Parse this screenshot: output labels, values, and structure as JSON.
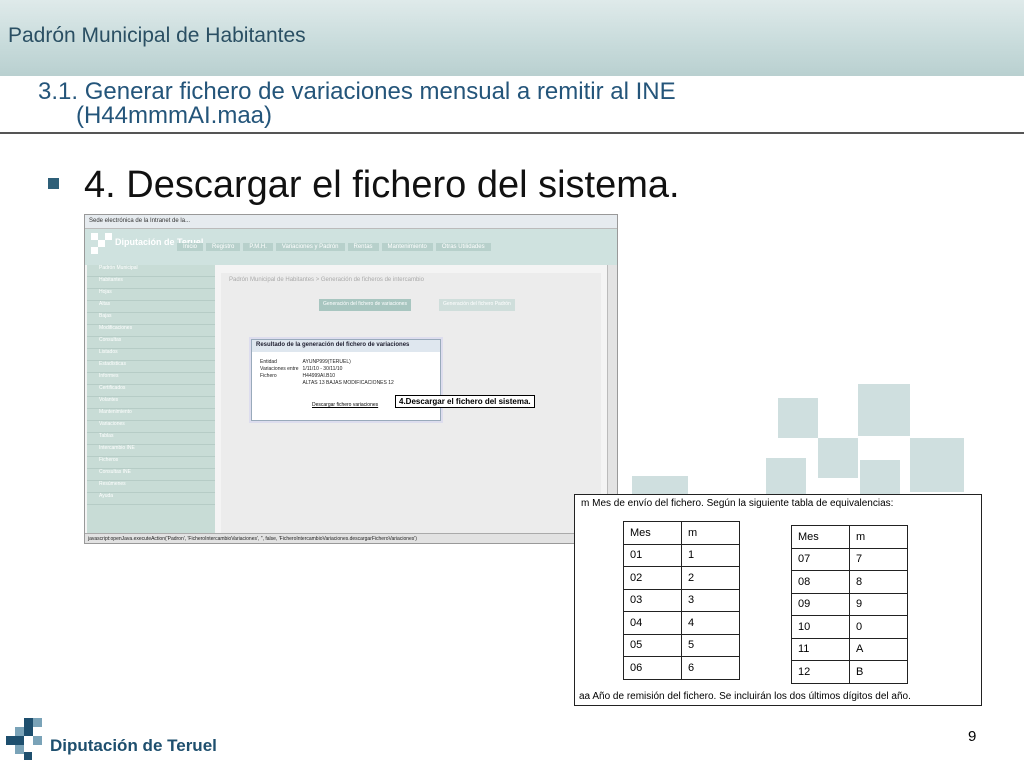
{
  "slide": {
    "app_title": "Padrón Municipal de Habitantes",
    "subtitle_line1": "3.1. Generar fichero de variaciones mensual a remitir al INE",
    "subtitle_line2": "(H44mmmAI.maa)",
    "bullet": "4. Descargar el fichero del sistema.",
    "page_number": "9",
    "footer_org": "Diputación de Teruel"
  },
  "screenshot": {
    "browser_tab": "Sede electrónica de la Intranet de la...",
    "logo_text": "Diputación de Teruel",
    "nav_items": [
      "Inicio",
      "Registro",
      "P.M.H.",
      "Variaciones y Padrón",
      "Rentas",
      "Mantenimiento",
      "Otras Utilidades"
    ],
    "breadcrumb": "Padrón Municipal de Habitantes > Generación de ficheros de intercambio",
    "tab_active": "Generación del fichero de variaciones",
    "tab_inactive": "Generación del fichero Padrón",
    "sidebar_items": [
      "Padrón Municipal",
      "Habitantes",
      "Hojas",
      "Altas",
      "Bajas",
      "Modificaciones",
      "Consultas",
      "Listados",
      "Estadísticas",
      "Informes",
      "Certificados",
      "Volantes",
      "Mantenimiento",
      "Variaciones",
      "Tablas",
      "Intercambio INE",
      "Ficheros",
      "Consultas INE",
      "Resúmenes",
      "Ayuda"
    ],
    "dialog": {
      "title": "Resultado de la generación del fichero de variaciones",
      "rows": [
        {
          "label": "Entidad",
          "value": "AYUNP999(TERUEL)"
        },
        {
          "label": "Variaciones entre",
          "value": "1/11/10 - 30/11/10"
        },
        {
          "label": "Fichero",
          "value": "H44999AI.B10"
        }
      ],
      "altas_label": "ALTAS",
      "altas_value": "13",
      "bajas_label": "BAJAS",
      "modif_label": "MODIFICACIONES",
      "modif_value": "12",
      "download_link": "Descargar fichero variaciones"
    },
    "callout": "4.Descargar el fichero del sistema.",
    "status_bar": "javascript:openJava.executeAction('Padron', 'FicheroIntercambioVariaciones', '', false, 'FicheroIntercambioVariaciones.descargarFicheroVariaciones')"
  },
  "equivalence": {
    "header": "m   Mes de envío del fichero. Según la siguiente tabla de equivalencias:",
    "footer": "aa Año de remisión del fichero. Se incluirán los dos últimos dígitos del año.",
    "col_mes": "Mes",
    "col_m": "m",
    "table1": [
      [
        "01",
        "1"
      ],
      [
        "02",
        "2"
      ],
      [
        "03",
        "3"
      ],
      [
        "04",
        "4"
      ],
      [
        "05",
        "5"
      ],
      [
        "06",
        "6"
      ]
    ],
    "table2": [
      [
        "07",
        "7"
      ],
      [
        "08",
        "8"
      ],
      [
        "09",
        "9"
      ],
      [
        "10",
        "0"
      ],
      [
        "11",
        "A"
      ],
      [
        "12",
        "B"
      ]
    ]
  }
}
